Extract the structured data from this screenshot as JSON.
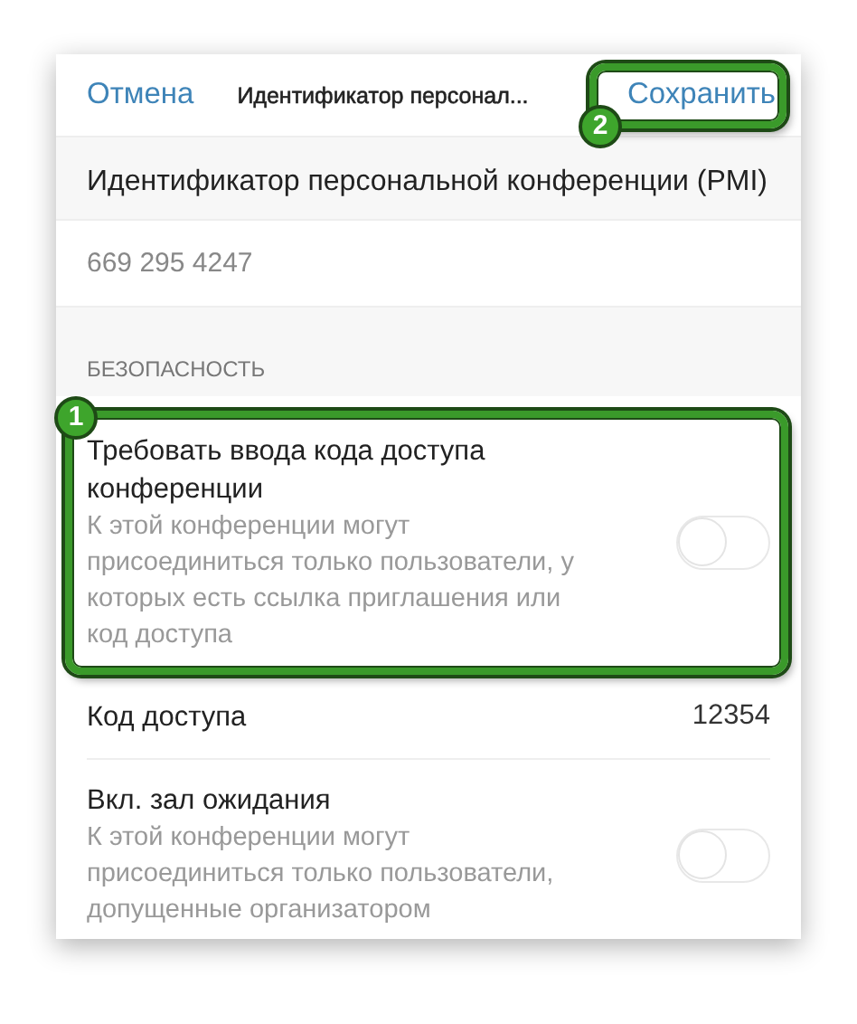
{
  "header": {
    "cancel": "Отмена",
    "title": "Идентификатор персонал...",
    "save": "Сохранить",
    "save_callout": "2"
  },
  "pmi": {
    "label": "Идентификатор персональной конференции (PMI)",
    "value": "669 295 4247"
  },
  "section": "БЕЗОПАСНОСТЬ",
  "settings": [
    {
      "kind": "toggle",
      "title": "Требовать ввода кода доступа конференции",
      "description": "К этой конференции могут присоединиться только пользователи, у которых есть ссылка приглашения или код доступа",
      "on": false,
      "callout": "1"
    },
    {
      "kind": "value",
      "title": "Код доступа",
      "value": "12354"
    },
    {
      "kind": "toggle",
      "title": "Вкл. зал ожидания",
      "description": "К этой конференции могут присоединиться только пользователи, допущенные организатором",
      "on": false
    }
  ]
}
